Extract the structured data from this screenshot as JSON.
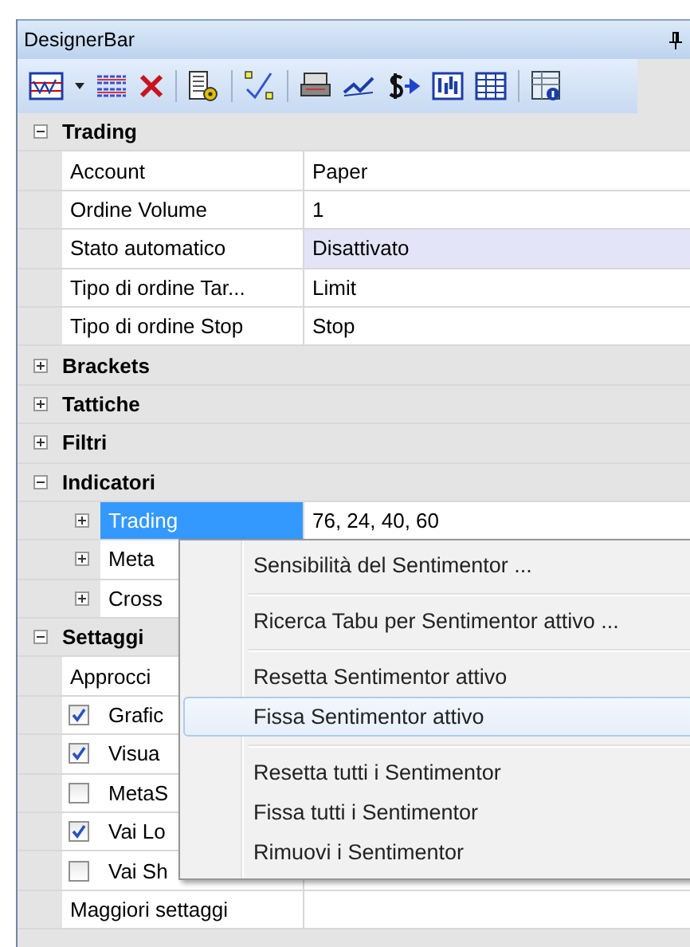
{
  "window": {
    "title": "DesignerBar"
  },
  "sections": [
    {
      "name": "Trading",
      "expanded": true,
      "items": [
        {
          "kind": "property",
          "name": "Account",
          "value": "Paper",
          "highlighted": false
        },
        {
          "kind": "property",
          "name": "Ordine Volume",
          "value": "1",
          "highlighted": false
        },
        {
          "kind": "property",
          "name": "Stato automatico",
          "value": "Disattivato",
          "highlighted": true
        },
        {
          "kind": "property",
          "name": "Tipo di ordine Tar...",
          "value": "Limit",
          "highlighted": false
        },
        {
          "kind": "property",
          "name": "Tipo di ordine Stop",
          "value": "Stop",
          "highlighted": false
        }
      ]
    },
    {
      "name": "Brackets",
      "expanded": false
    },
    {
      "name": "Tattiche",
      "expanded": false
    },
    {
      "name": "Filtri",
      "expanded": false
    },
    {
      "name": "Indicatori",
      "expanded": true,
      "items": [
        {
          "kind": "subcategory",
          "name": "Trading",
          "value": "76, 24, 40, 60",
          "expanded": false,
          "selected": true
        },
        {
          "kind": "subcategory",
          "name": "Meta",
          "expanded": false,
          "selected": false
        },
        {
          "kind": "subcategory",
          "name": "Cross",
          "expanded": false,
          "selected": false
        }
      ]
    },
    {
      "name": "Settaggi",
      "expanded": true,
      "items": [
        {
          "kind": "property",
          "name": "Approcci"
        },
        {
          "kind": "checkbox",
          "name": "Grafic",
          "checked": true
        },
        {
          "kind": "checkbox",
          "name": "Visua",
          "checked": true
        },
        {
          "kind": "checkbox",
          "name": "MetaS",
          "checked": false
        },
        {
          "kind": "checkbox",
          "name": "Vai Lo",
          "checked": true
        },
        {
          "kind": "checkbox",
          "name": "Vai Sh",
          "checked": false
        },
        {
          "kind": "property",
          "name": "Maggiori settaggi",
          "highlighted": false
        }
      ]
    }
  ],
  "context_menu": {
    "items": [
      {
        "kind": "item",
        "label": "Sensibilità del Sentimentor ...",
        "selected": false
      },
      {
        "kind": "separator"
      },
      {
        "kind": "item",
        "label": "Ricerca Tabu per Sentimentor attivo ...",
        "selected": false
      },
      {
        "kind": "separator"
      },
      {
        "kind": "item",
        "label": "Resetta Sentimentor attivo",
        "selected": false
      },
      {
        "kind": "item",
        "label": "Fissa Sentimentor attivo",
        "selected": true
      },
      {
        "kind": "separator"
      },
      {
        "kind": "item",
        "label": "Resetta tutti i Sentimentor",
        "selected": false
      },
      {
        "kind": "item",
        "label": "Fissa tutti i Sentimentor",
        "selected": false
      },
      {
        "kind": "item",
        "label": "Rimuovi i Sentimentor",
        "selected": false
      }
    ]
  }
}
